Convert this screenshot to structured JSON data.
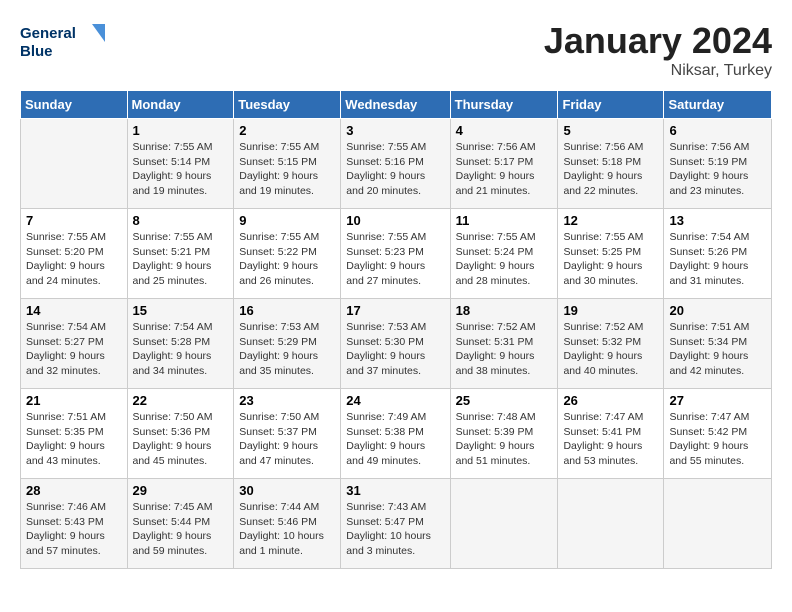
{
  "logo": {
    "line1": "General",
    "line2": "Blue"
  },
  "title": "January 2024",
  "subtitle": "Niksar, Turkey",
  "days_of_week": [
    "Sunday",
    "Monday",
    "Tuesday",
    "Wednesday",
    "Thursday",
    "Friday",
    "Saturday"
  ],
  "weeks": [
    [
      {
        "day": "",
        "info": ""
      },
      {
        "day": "1",
        "info": "Sunrise: 7:55 AM\nSunset: 5:14 PM\nDaylight: 9 hours\nand 19 minutes."
      },
      {
        "day": "2",
        "info": "Sunrise: 7:55 AM\nSunset: 5:15 PM\nDaylight: 9 hours\nand 19 minutes."
      },
      {
        "day": "3",
        "info": "Sunrise: 7:55 AM\nSunset: 5:16 PM\nDaylight: 9 hours\nand 20 minutes."
      },
      {
        "day": "4",
        "info": "Sunrise: 7:56 AM\nSunset: 5:17 PM\nDaylight: 9 hours\nand 21 minutes."
      },
      {
        "day": "5",
        "info": "Sunrise: 7:56 AM\nSunset: 5:18 PM\nDaylight: 9 hours\nand 22 minutes."
      },
      {
        "day": "6",
        "info": "Sunrise: 7:56 AM\nSunset: 5:19 PM\nDaylight: 9 hours\nand 23 minutes."
      }
    ],
    [
      {
        "day": "7",
        "info": "Sunrise: 7:55 AM\nSunset: 5:20 PM\nDaylight: 9 hours\nand 24 minutes."
      },
      {
        "day": "8",
        "info": "Sunrise: 7:55 AM\nSunset: 5:21 PM\nDaylight: 9 hours\nand 25 minutes."
      },
      {
        "day": "9",
        "info": "Sunrise: 7:55 AM\nSunset: 5:22 PM\nDaylight: 9 hours\nand 26 minutes."
      },
      {
        "day": "10",
        "info": "Sunrise: 7:55 AM\nSunset: 5:23 PM\nDaylight: 9 hours\nand 27 minutes."
      },
      {
        "day": "11",
        "info": "Sunrise: 7:55 AM\nSunset: 5:24 PM\nDaylight: 9 hours\nand 28 minutes."
      },
      {
        "day": "12",
        "info": "Sunrise: 7:55 AM\nSunset: 5:25 PM\nDaylight: 9 hours\nand 30 minutes."
      },
      {
        "day": "13",
        "info": "Sunrise: 7:54 AM\nSunset: 5:26 PM\nDaylight: 9 hours\nand 31 minutes."
      }
    ],
    [
      {
        "day": "14",
        "info": "Sunrise: 7:54 AM\nSunset: 5:27 PM\nDaylight: 9 hours\nand 32 minutes."
      },
      {
        "day": "15",
        "info": "Sunrise: 7:54 AM\nSunset: 5:28 PM\nDaylight: 9 hours\nand 34 minutes."
      },
      {
        "day": "16",
        "info": "Sunrise: 7:53 AM\nSunset: 5:29 PM\nDaylight: 9 hours\nand 35 minutes."
      },
      {
        "day": "17",
        "info": "Sunrise: 7:53 AM\nSunset: 5:30 PM\nDaylight: 9 hours\nand 37 minutes."
      },
      {
        "day": "18",
        "info": "Sunrise: 7:52 AM\nSunset: 5:31 PM\nDaylight: 9 hours\nand 38 minutes."
      },
      {
        "day": "19",
        "info": "Sunrise: 7:52 AM\nSunset: 5:32 PM\nDaylight: 9 hours\nand 40 minutes."
      },
      {
        "day": "20",
        "info": "Sunrise: 7:51 AM\nSunset: 5:34 PM\nDaylight: 9 hours\nand 42 minutes."
      }
    ],
    [
      {
        "day": "21",
        "info": "Sunrise: 7:51 AM\nSunset: 5:35 PM\nDaylight: 9 hours\nand 43 minutes."
      },
      {
        "day": "22",
        "info": "Sunrise: 7:50 AM\nSunset: 5:36 PM\nDaylight: 9 hours\nand 45 minutes."
      },
      {
        "day": "23",
        "info": "Sunrise: 7:50 AM\nSunset: 5:37 PM\nDaylight: 9 hours\nand 47 minutes."
      },
      {
        "day": "24",
        "info": "Sunrise: 7:49 AM\nSunset: 5:38 PM\nDaylight: 9 hours\nand 49 minutes."
      },
      {
        "day": "25",
        "info": "Sunrise: 7:48 AM\nSunset: 5:39 PM\nDaylight: 9 hours\nand 51 minutes."
      },
      {
        "day": "26",
        "info": "Sunrise: 7:47 AM\nSunset: 5:41 PM\nDaylight: 9 hours\nand 53 minutes."
      },
      {
        "day": "27",
        "info": "Sunrise: 7:47 AM\nSunset: 5:42 PM\nDaylight: 9 hours\nand 55 minutes."
      }
    ],
    [
      {
        "day": "28",
        "info": "Sunrise: 7:46 AM\nSunset: 5:43 PM\nDaylight: 9 hours\nand 57 minutes."
      },
      {
        "day": "29",
        "info": "Sunrise: 7:45 AM\nSunset: 5:44 PM\nDaylight: 9 hours\nand 59 minutes."
      },
      {
        "day": "30",
        "info": "Sunrise: 7:44 AM\nSunset: 5:46 PM\nDaylight: 10 hours\nand 1 minute."
      },
      {
        "day": "31",
        "info": "Sunrise: 7:43 AM\nSunset: 5:47 PM\nDaylight: 10 hours\nand 3 minutes."
      },
      {
        "day": "",
        "info": ""
      },
      {
        "day": "",
        "info": ""
      },
      {
        "day": "",
        "info": ""
      }
    ]
  ]
}
